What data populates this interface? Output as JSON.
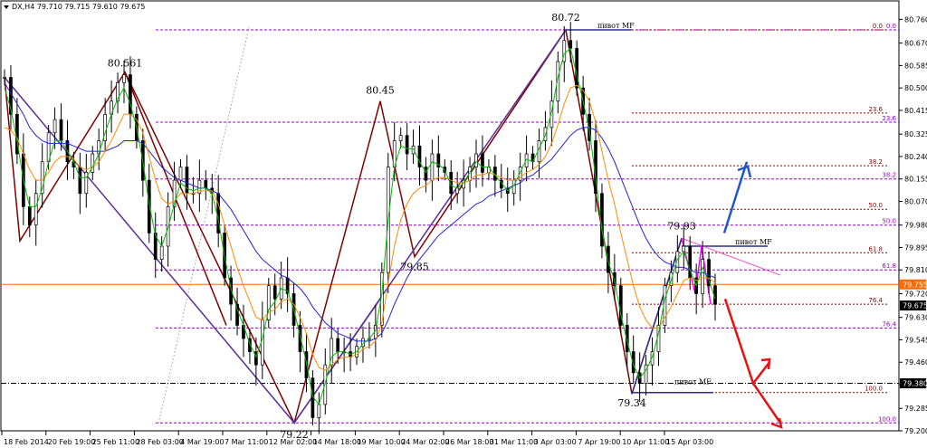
{
  "chart_data": {
    "type": "candlestick",
    "symbol_header": "DX,H4  79.710 79.715 79.610 79.675",
    "ylim": [
      79.2,
      80.83
    ],
    "y_ticks": [
      "80.760",
      "80.670",
      "80.585",
      "80.500",
      "80.415",
      "80.325",
      "80.240",
      "80.155",
      "80.070",
      "79.980",
      "79.895",
      "79.810",
      "79.720",
      "79.630",
      "79.545",
      "79.460",
      "79.375",
      "79.285",
      "79.200"
    ],
    "x_ticks": [
      "18 Feb 2014",
      "20 Feb 19:00",
      "25 Feb 11:00",
      "28 Feb 03:00",
      "4 Mar 19:00",
      "7 Mar 11:00",
      "12 Mar 02:00",
      "14 Mar 18:00",
      "19 Mar 10:00",
      "24 Mar 02:00",
      "26 Mar 18:00",
      "31 Mar 11:00",
      "3 Apr 03:00",
      "7 Apr 19:00",
      "10 Apr 11:00",
      "15 Apr 03:00"
    ],
    "price_badges": [
      {
        "label": "79.755",
        "value": 79.755,
        "color": "#ff6a00"
      },
      {
        "label": "79.675",
        "value": 79.675,
        "color": "#000000"
      },
      {
        "label": "79.380",
        "value": 79.38,
        "color": "#000000"
      }
    ],
    "pivot_labels": [
      {
        "text": "80.561",
        "value": 80.561
      },
      {
        "text": "80.45",
        "value": 80.45
      },
      {
        "text": "80.72",
        "value": 80.72
      },
      {
        "text": "79.85",
        "value": 79.85
      },
      {
        "text": "79.93",
        "value": 79.93
      },
      {
        "text": "79.34",
        "value": 79.34
      },
      {
        "text": "79.22",
        "value": 79.22
      }
    ],
    "fib_left": {
      "color": "#9900cc",
      "levels": [
        {
          "label": "0.0",
          "value": 80.72
        },
        {
          "label": "23.6",
          "value": 80.37
        },
        {
          "label": "38.2",
          "value": 80.155
        },
        {
          "label": "50.0",
          "value": 79.98
        },
        {
          "label": "61.8",
          "value": 79.81
        },
        {
          "label": "76.4",
          "value": 79.59
        },
        {
          "label": "100.0",
          "value": 79.23
        }
      ]
    },
    "fib_right": {
      "color": "#8b0000",
      "levels": [
        {
          "label": "0.0",
          "value": 80.72
        },
        {
          "label": "23.6",
          "value": 80.405
        },
        {
          "label": "38.2",
          "value": 80.205
        },
        {
          "label": "50.0",
          "value": 80.04
        },
        {
          "label": "61.8",
          "value": 79.875
        },
        {
          "label": "76.4",
          "value": 79.68
        },
        {
          "label": "100.0",
          "value": 79.345
        }
      ]
    },
    "pivot_mf_label": "пивот MF",
    "series": [
      {
        "type": "candles",
        "color": "#000000"
      },
      {
        "type": "ma_fast",
        "color": "#00bb00"
      },
      {
        "type": "ma_mid",
        "color": "#ff8c00"
      },
      {
        "type": "ma_slow",
        "color": "#2222dd"
      }
    ],
    "candle_close": [
      80.54,
      80.4,
      80.25,
      80.05,
      79.98,
      80.1,
      80.22,
      80.33,
      80.38,
      80.3,
      80.22,
      80.2,
      80.1,
      80.18,
      80.25,
      80.3,
      80.4,
      80.45,
      80.52,
      80.55,
      80.4,
      80.3,
      80.15,
      79.95,
      79.85,
      79.9,
      80.05,
      80.15,
      80.2,
      80.1,
      80.1,
      80.15,
      80.12,
      80.1,
      79.95,
      79.78,
      79.68,
      79.6,
      79.55,
      79.5,
      79.45,
      79.62,
      79.75,
      79.7,
      79.78,
      79.72,
      79.6,
      79.5,
      79.4,
      79.25,
      79.3,
      79.45,
      79.55,
      79.5,
      79.5,
      79.48,
      79.52,
      79.55,
      79.55,
      79.6,
      79.8,
      80.2,
      80.3,
      80.32,
      80.25,
      80.28,
      80.2,
      80.15,
      80.25,
      80.2,
      80.18,
      80.1,
      80.12,
      80.15,
      80.2,
      80.25,
      80.18,
      80.2,
      80.15,
      80.12,
      80.1,
      80.15,
      80.2,
      80.25,
      80.22,
      80.3,
      80.35,
      80.45,
      80.6,
      80.68,
      80.65,
      80.5,
      80.4,
      80.3,
      80.1,
      79.9,
      79.8,
      79.75,
      79.6,
      79.5,
      79.42,
      79.38,
      79.45,
      79.5,
      79.6,
      79.75,
      79.8,
      79.88,
      79.9,
      79.78,
      79.72,
      79.85,
      79.75,
      79.68
    ],
    "ma_fast": [
      80.5,
      80.42,
      80.3,
      80.15,
      80.05,
      80.05,
      80.12,
      80.22,
      80.3,
      80.3,
      80.26,
      80.22,
      80.16,
      80.16,
      80.2,
      80.25,
      80.33,
      80.4,
      80.46,
      80.5,
      80.44,
      80.35,
      80.22,
      80.06,
      79.94,
      79.9,
      79.97,
      80.06,
      80.14,
      80.12,
      80.11,
      80.12,
      80.12,
      80.1,
      80.0,
      79.86,
      79.74,
      79.66,
      79.6,
      79.53,
      79.48,
      79.55,
      79.66,
      79.69,
      79.74,
      79.73,
      79.66,
      79.56,
      79.46,
      79.33,
      79.3,
      79.38,
      79.48,
      79.5,
      79.5,
      79.49,
      79.5,
      79.53,
      79.55,
      79.58,
      79.72,
      80.0,
      80.2,
      80.28,
      80.27,
      80.27,
      80.22,
      80.18,
      80.22,
      80.21,
      80.19,
      80.13,
      80.12,
      80.14,
      80.18,
      80.22,
      80.2,
      80.2,
      80.17,
      80.14,
      80.11,
      80.13,
      80.18,
      80.23,
      80.22,
      80.27,
      80.32,
      80.41,
      80.54,
      80.63,
      80.65,
      80.55,
      80.45,
      80.34,
      80.16,
      79.96,
      79.84,
      79.77,
      79.64,
      79.54,
      79.45,
      79.4,
      79.43,
      79.48,
      79.57,
      79.7,
      79.77,
      79.85,
      79.88,
      79.81,
      79.75,
      79.82,
      79.77,
      79.7
    ],
    "ma_mid": [
      80.35,
      80.34,
      80.31,
      80.25,
      80.19,
      80.15,
      80.15,
      80.18,
      80.22,
      80.24,
      80.24,
      80.23,
      80.2,
      80.19,
      80.2,
      80.22,
      80.26,
      80.3,
      80.35,
      80.4,
      80.4,
      80.38,
      80.33,
      80.24,
      80.15,
      80.08,
      80.06,
      80.07,
      80.1,
      80.1,
      80.1,
      80.11,
      80.11,
      80.11,
      80.06,
      79.98,
      79.9,
      79.82,
      79.75,
      79.69,
      79.63,
      79.62,
      79.65,
      79.66,
      79.69,
      79.7,
      79.68,
      79.63,
      79.57,
      79.49,
      79.44,
      79.43,
      79.45,
      79.47,
      79.48,
      79.48,
      79.49,
      79.51,
      79.52,
      79.54,
      79.61,
      79.76,
      79.9,
      80.0,
      80.06,
      80.1,
      80.12,
      80.13,
      80.15,
      80.16,
      80.16,
      80.15,
      80.14,
      80.14,
      80.15,
      80.17,
      80.17,
      80.18,
      80.17,
      80.16,
      80.15,
      80.15,
      80.16,
      80.18,
      80.19,
      80.21,
      80.24,
      80.29,
      80.36,
      80.44,
      80.5,
      80.51,
      80.49,
      80.45,
      80.37,
      80.26,
      80.15,
      80.06,
      79.95,
      79.85,
      79.75,
      79.67,
      79.62,
      79.59,
      79.59,
      79.63,
      79.67,
      79.72,
      79.77,
      79.78,
      79.77,
      79.78,
      79.78,
      79.76
    ],
    "ma_slow": [
      80.52,
      80.48,
      80.44,
      80.4,
      80.35,
      80.32,
      80.3,
      80.29,
      80.29,
      80.29,
      80.29,
      80.28,
      80.27,
      80.26,
      80.26,
      80.26,
      80.26,
      80.27,
      80.28,
      80.3,
      80.3,
      80.3,
      80.29,
      80.26,
      80.23,
      80.2,
      80.18,
      80.16,
      80.15,
      80.14,
      80.13,
      80.12,
      80.12,
      80.11,
      80.1,
      80.07,
      80.04,
      80.0,
      79.96,
      79.92,
      79.88,
      79.85,
      79.83,
      79.81,
      79.79,
      79.78,
      79.76,
      79.74,
      79.71,
      79.67,
      79.64,
      79.61,
      79.59,
      79.57,
      79.56,
      79.55,
      79.54,
      79.54,
      79.54,
      79.55,
      79.57,
      79.62,
      79.68,
      79.73,
      79.78,
      79.82,
      79.85,
      79.88,
      79.91,
      79.94,
      79.96,
      79.98,
      80.0,
      80.02,
      80.04,
      80.06,
      80.07,
      80.09,
      80.1,
      80.11,
      80.12,
      80.13,
      80.14,
      80.16,
      80.17,
      80.19,
      80.21,
      80.23,
      80.26,
      80.29,
      80.32,
      80.34,
      80.35,
      80.35,
      80.34,
      80.31,
      80.27,
      80.22,
      80.16,
      80.1,
      80.04,
      79.98,
      79.93,
      79.89,
      79.86,
      79.84,
      79.83,
      79.82,
      79.82,
      79.81,
      79.8,
      79.8,
      79.79,
      79.78
    ]
  }
}
